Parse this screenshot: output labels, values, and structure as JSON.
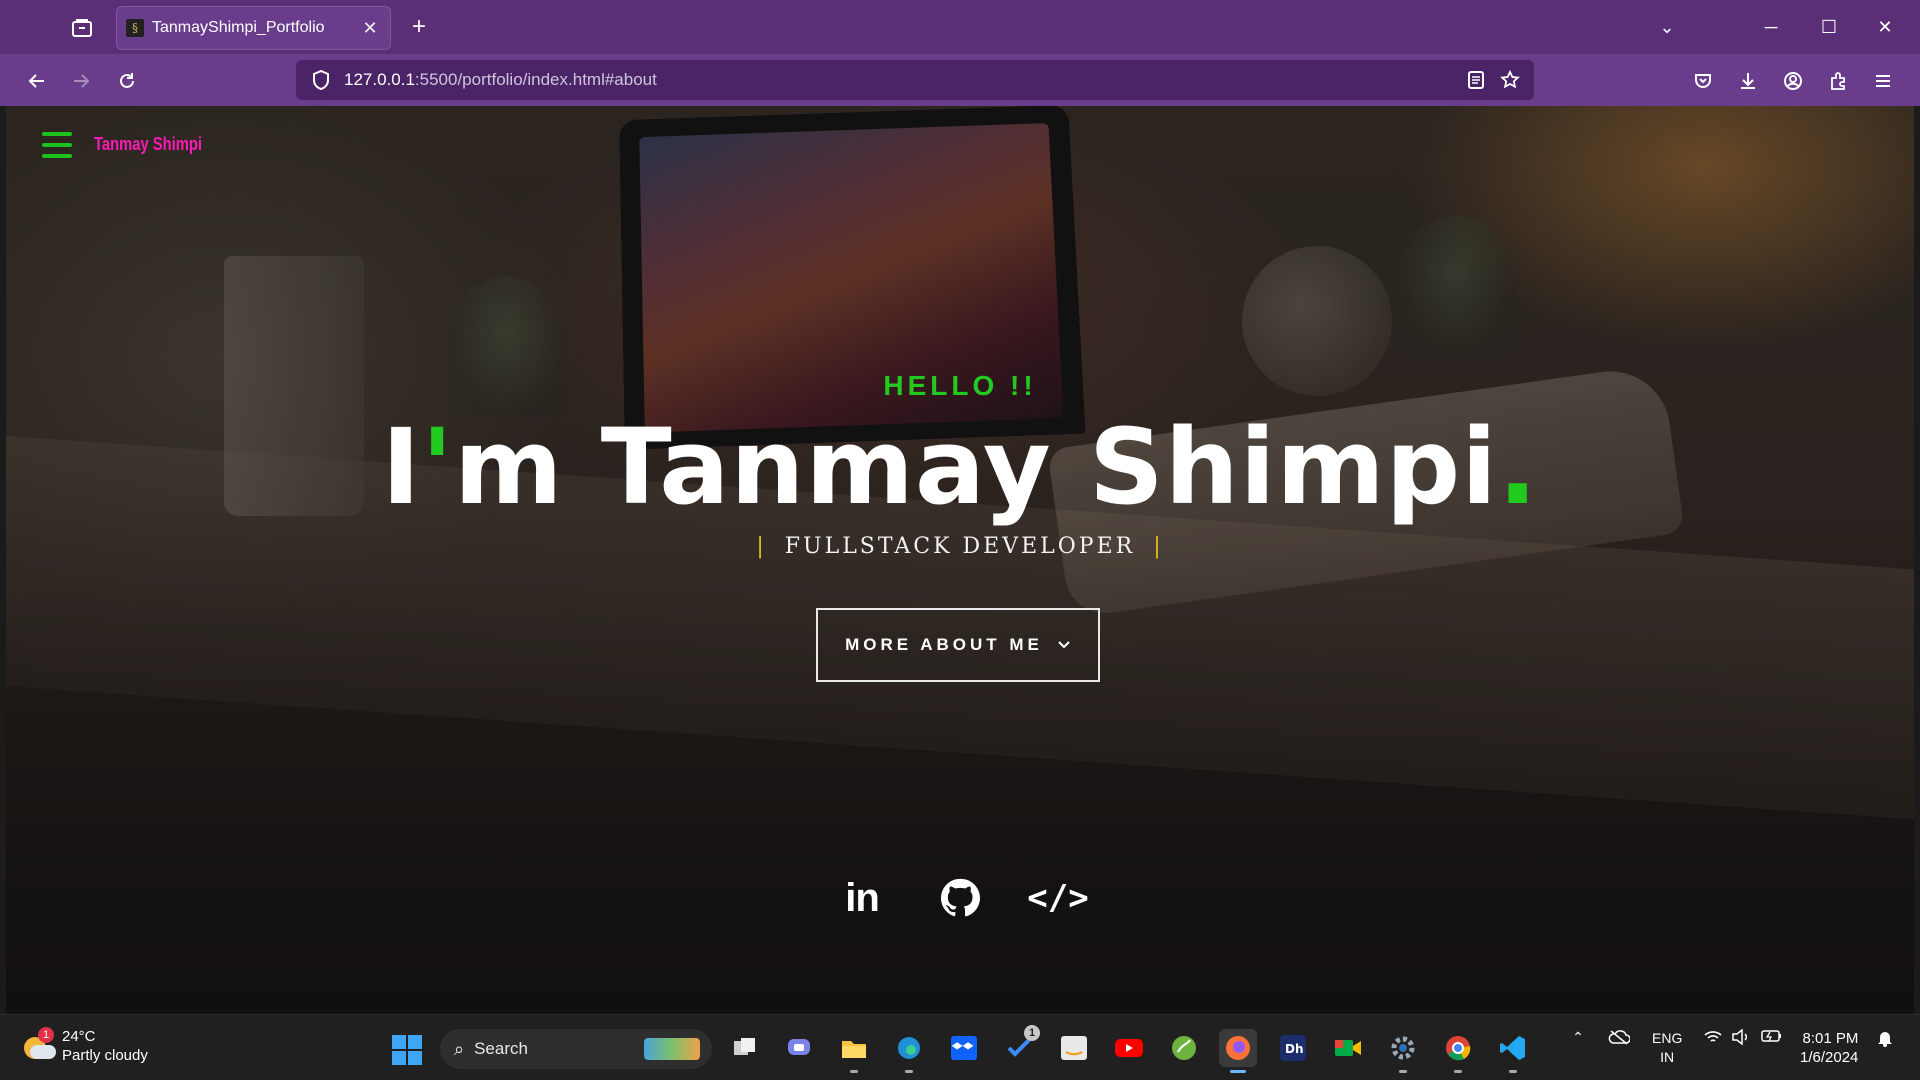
{
  "browser": {
    "tab_title": "TanmayShimpi_Portfolio",
    "url_host": "127.0.0.1",
    "url_path": ":5500/portfolio/index.html#about",
    "accent_color": "#5a2f78"
  },
  "site": {
    "brand": "Tanmay Shimpi",
    "hello": "HELLO !!",
    "name_prefix": "I",
    "name_apostrophe": "'",
    "name_rest": "m Tanmay Shimpi",
    "name_dot": ".",
    "role": "FULLSTACK DEVELOPER",
    "role_separator": "|",
    "cta_label": "MORE ABOUT ME",
    "socials": [
      {
        "icon": "linkedin-icon",
        "label": "in"
      },
      {
        "icon": "github-icon"
      },
      {
        "icon": "code-icon",
        "label": "</>"
      }
    ],
    "colors": {
      "green": "#22c91e",
      "pink": "#ff1ab8",
      "gold": "#e2c01a"
    }
  },
  "taskbar": {
    "weather_temp": "24°C",
    "weather_desc": "Partly cloudy",
    "weather_badge": "1",
    "search_label": "Search",
    "todo_badge": "1",
    "lang_top": "ENG",
    "lang_bottom": "IN",
    "time": "8:01 PM",
    "date": "1/6/2024"
  }
}
